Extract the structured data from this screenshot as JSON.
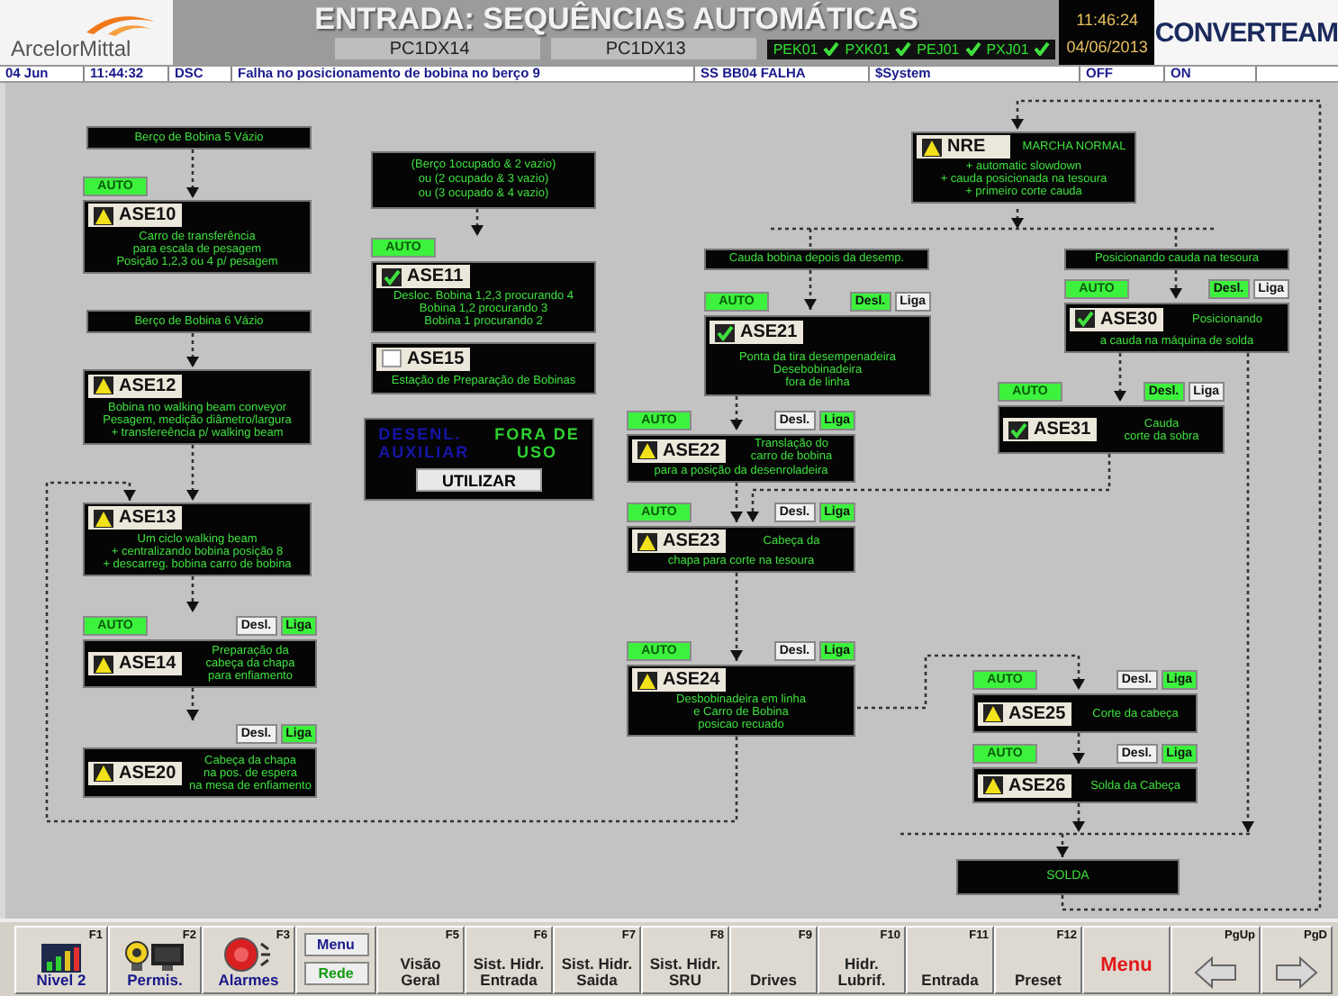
{
  "header": {
    "brand": "ArcelorMittal",
    "title": "ENTRADA: SEQUÊNCIAS AUTOMÁTICAS",
    "servers": [
      "PC1DX14",
      "PC1DX13"
    ],
    "links": [
      {
        "label": "PEK01",
        "ok": true
      },
      {
        "label": "PXK01",
        "ok": true
      },
      {
        "label": "PEJ01",
        "ok": true
      },
      {
        "label": "PXJ01",
        "ok": true
      }
    ],
    "time": "11:46:24",
    "date": "04/06/2013",
    "vendor": "CONVERTEAM"
  },
  "alarm_bar": [
    "04 Jun",
    "11:44:32",
    "DSC",
    "Falha no posicionamento de bobina no berço 9",
    "SS  BB04  FALHA",
    "$System",
    "OFF",
    "ON"
  ],
  "nodes": [
    {
      "kind": "condition",
      "lines": [
        "Berço de Bobina 5 Vázio"
      ]
    },
    {
      "kind": "sequence",
      "code": "ASE10",
      "alarm": true,
      "auto": "AUTO",
      "description": [
        "Carro de transferência",
        "para escala de pesagem",
        "Posição 1,2,3 ou 4 p/ pesagem"
      ]
    },
    {
      "kind": "condition",
      "lines": [
        "Berço de Bobina 6 Vázio"
      ]
    },
    {
      "kind": "sequence",
      "code": "ASE12",
      "alarm": true,
      "description": [
        "Bobina no walking beam conveyor",
        "Pesagem, medição diâmetro/largura",
        "+ transfereência p/ walking beam"
      ]
    },
    {
      "kind": "sequence",
      "code": "ASE13",
      "alarm": true,
      "description": [
        "Um ciclo walking beam",
        "+ centralizando bobina posição 8",
        "+ descarreg. bobina carro de bobina"
      ]
    },
    {
      "kind": "sequence",
      "code": "ASE14",
      "alarm": true,
      "auto": "AUTO",
      "switch": [
        {
          "label": "Desl.",
          "selected": false
        },
        {
          "label": "Liga",
          "selected": true
        }
      ],
      "beside": [
        "Preparação da",
        "cabeça da chapa",
        "para enfiamento"
      ]
    },
    {
      "kind": "sequence",
      "code": "ASE20",
      "alarm": true,
      "switch": [
        {
          "label": "Desl.",
          "selected": false
        },
        {
          "label": "Liga",
          "selected": true
        }
      ],
      "beside": [
        "Cabeça da chapa",
        "na pos. de espera",
        "na mesa de enfiamento"
      ]
    },
    {
      "kind": "condition",
      "lines": [
        "(Berço 1ocupado & 2 vazio)",
        "ou (2 ocupado  & 3 vazio)",
        "ou (3 ocupado & 4 vazio)"
      ]
    },
    {
      "kind": "sequence",
      "code": "ASE11",
      "alarm": false,
      "checked": true,
      "auto": "AUTO",
      "description": [
        "Desloc. Bobina 1,2,3 procurando 4",
        "Bobina 1,2 procurando 3",
        "Bobina 1 procurando 2"
      ]
    },
    {
      "kind": "sequence",
      "code": "ASE15",
      "alarm": false,
      "checked": false,
      "description": [
        "Estação de Preparação de Bobinas"
      ]
    },
    {
      "kind": "panel",
      "left": [
        "DESENL.",
        "AUXILIAR"
      ],
      "right": [
        "FORA DE",
        "USO"
      ],
      "button": "UTILIZAR"
    },
    {
      "kind": "sequence",
      "code": "NRE",
      "alarm": true,
      "beside": [
        "MARCHA NORMAL"
      ],
      "description": [
        "+ automatic slowdown",
        "+ cauda posicionada na tesoura",
        "+ primeiro corte cauda"
      ]
    },
    {
      "kind": "condition",
      "lines": [
        "Cauda bobina depois da desemp."
      ]
    },
    {
      "kind": "sequence",
      "code": "ASE21",
      "alarm": false,
      "checked": true,
      "auto": "AUTO",
      "switch": [
        {
          "label": "Desl.",
          "selected": true
        },
        {
          "label": "Liga",
          "selected": false
        }
      ],
      "description": [
        "Ponta da tira desempenadeira",
        "Desebobinadeira",
        "fora de linha"
      ]
    },
    {
      "kind": "sequence",
      "code": "ASE22",
      "alarm": true,
      "auto": "AUTO",
      "switch": [
        {
          "label": "Desl.",
          "selected": false
        },
        {
          "label": "Liga",
          "selected": true
        }
      ],
      "beside": [
        "Translação do",
        "carro de bobina"
      ],
      "description": [
        "para a posição da desenroladeira"
      ]
    },
    {
      "kind": "sequence",
      "code": "ASE23",
      "alarm": true,
      "auto": "AUTO",
      "switch": [
        {
          "label": "Desl.",
          "selected": false
        },
        {
          "label": "Liga",
          "selected": true
        }
      ],
      "beside": [
        "Cabeça da"
      ],
      "description": [
        "chapa para corte na tesoura"
      ]
    },
    {
      "kind": "sequence",
      "code": "ASE24",
      "alarm": true,
      "auto": "AUTO",
      "switch": [
        {
          "label": "Desl.",
          "selected": false
        },
        {
          "label": "Liga",
          "selected": true
        }
      ],
      "description": [
        "Desbobinadeira em linha",
        "e Carro de Bobina",
        "posicao recuado"
      ]
    },
    {
      "kind": "condition",
      "lines": [
        "Posicionando cauda na tesoura"
      ]
    },
    {
      "kind": "sequence",
      "code": "ASE30",
      "alarm": false,
      "checked": true,
      "auto": "AUTO",
      "switch": [
        {
          "label": "Desl.",
          "selected": true
        },
        {
          "label": "Liga",
          "selected": false
        }
      ],
      "beside": [
        "Posicionando"
      ],
      "description": [
        "a cauda na máquina de solda"
      ]
    },
    {
      "kind": "sequence",
      "code": "ASE31",
      "alarm": false,
      "checked": true,
      "auto": "AUTO",
      "switch": [
        {
          "label": "Desl.",
          "selected": true
        },
        {
          "label": "Liga",
          "selected": false
        }
      ],
      "beside": [
        "Cauda",
        "corte da sobra"
      ]
    },
    {
      "kind": "sequence",
      "code": "ASE25",
      "alarm": true,
      "auto": "AUTO",
      "switch": [
        {
          "label": "Desl.",
          "selected": false
        },
        {
          "label": "Liga",
          "selected": true
        }
      ],
      "beside": [
        "Corte da cabeça"
      ]
    },
    {
      "kind": "sequence",
      "code": "ASE26",
      "alarm": true,
      "auto": "AUTO",
      "switch": [
        {
          "label": "Desl.",
          "selected": false
        },
        {
          "label": "Liga",
          "selected": true
        }
      ],
      "beside": [
        "Solda da Cabeça"
      ]
    },
    {
      "kind": "terminal",
      "lines": [
        "SOLDA"
      ]
    }
  ],
  "function_keys": [
    {
      "kind": "chart",
      "key": "F1",
      "lines": [
        "Nivel 2"
      ]
    },
    {
      "kind": "camera",
      "key": "F2",
      "lines": [
        "Permis."
      ]
    },
    {
      "kind": "alarm",
      "key": "F3",
      "lines": [
        "Alarmes"
      ]
    },
    {
      "kind": "pair",
      "lines": [
        "Menu",
        "Rede"
      ]
    },
    {
      "kind": "text",
      "key": "F5",
      "lines": [
        "Visão",
        "Geral"
      ]
    },
    {
      "kind": "text",
      "key": "F6",
      "lines": [
        "Sist. Hidr.",
        "Entrada"
      ]
    },
    {
      "kind": "text",
      "key": "F7",
      "lines": [
        "Sist. Hidr.",
        "Saida"
      ]
    },
    {
      "kind": "text",
      "key": "F8",
      "lines": [
        "Sist. Hidr.",
        "SRU"
      ]
    },
    {
      "kind": "text",
      "key": "F9",
      "lines": [
        "Drives"
      ]
    },
    {
      "kind": "text",
      "key": "F10",
      "lines": [
        "Hidr.",
        "Lubrif."
      ]
    },
    {
      "kind": "text",
      "key": "F11",
      "lines": [
        "Entrada"
      ]
    },
    {
      "kind": "text",
      "key": "F12",
      "lines": [
        "Preset"
      ]
    },
    {
      "kind": "menu",
      "lines": [
        "Menu"
      ]
    },
    {
      "kind": "prev",
      "key": "PgUp"
    },
    {
      "kind": "next",
      "key": "PgD"
    }
  ]
}
